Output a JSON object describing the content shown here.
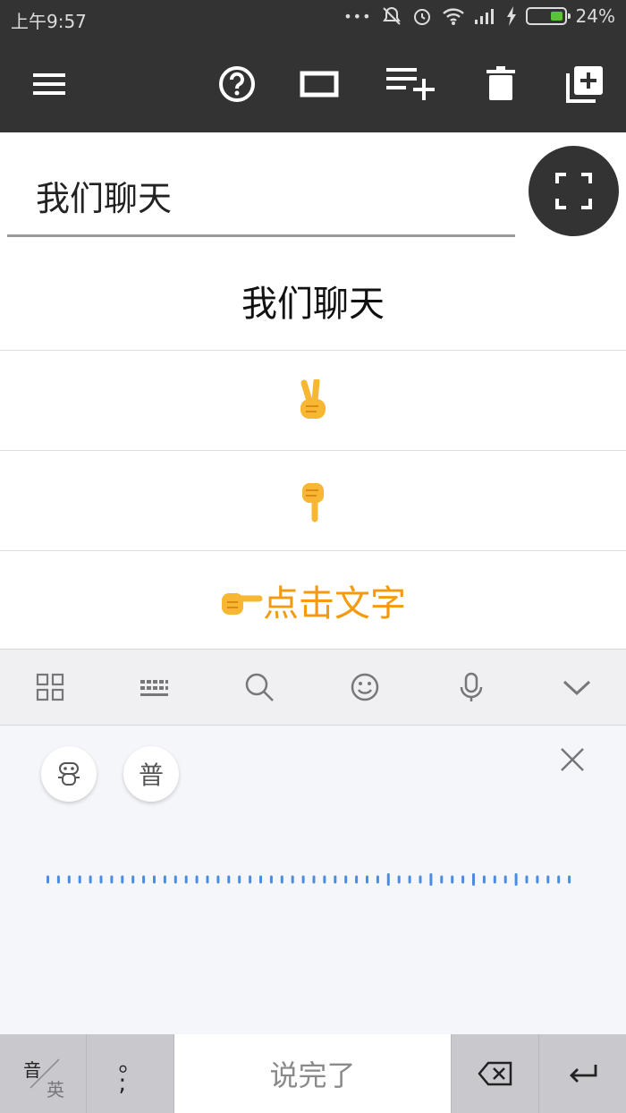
{
  "status_bar": {
    "time": "上午9:57",
    "dots": "•••",
    "battery_text": "24%"
  },
  "toolbar": {
    "icons": [
      "menu-icon",
      "help-icon",
      "fullscreen-rect-icon",
      "playlist-add-icon",
      "delete-icon",
      "add-box-icon"
    ]
  },
  "input": {
    "value": "我们聊天"
  },
  "list": {
    "items": [
      {
        "text": "我们聊天",
        "kind": "text"
      },
      {
        "text": "",
        "kind": "victory-hand-emoji"
      },
      {
        "text": "",
        "kind": "pointing-down-emoji"
      },
      {
        "text": "点击文字",
        "kind": "pointing-right-emoji"
      }
    ],
    "accent_color": "#f59a0c"
  },
  "keyboard": {
    "toolbar_icons": [
      "grid-icon",
      "keyboard-icon",
      "search-icon",
      "emoji-icon",
      "microphone-icon",
      "chevron-down-icon"
    ],
    "voice": {
      "mode_button_label": "普",
      "close_icon": "close-icon"
    },
    "bottom": {
      "switch_top": "音",
      "switch_bottom": "英",
      "punct_label": "。\n;",
      "space_label": "说完了",
      "delete_icon": "backspace-icon",
      "enter_icon": "enter-icon"
    },
    "wave_color": "#4a8de0"
  }
}
